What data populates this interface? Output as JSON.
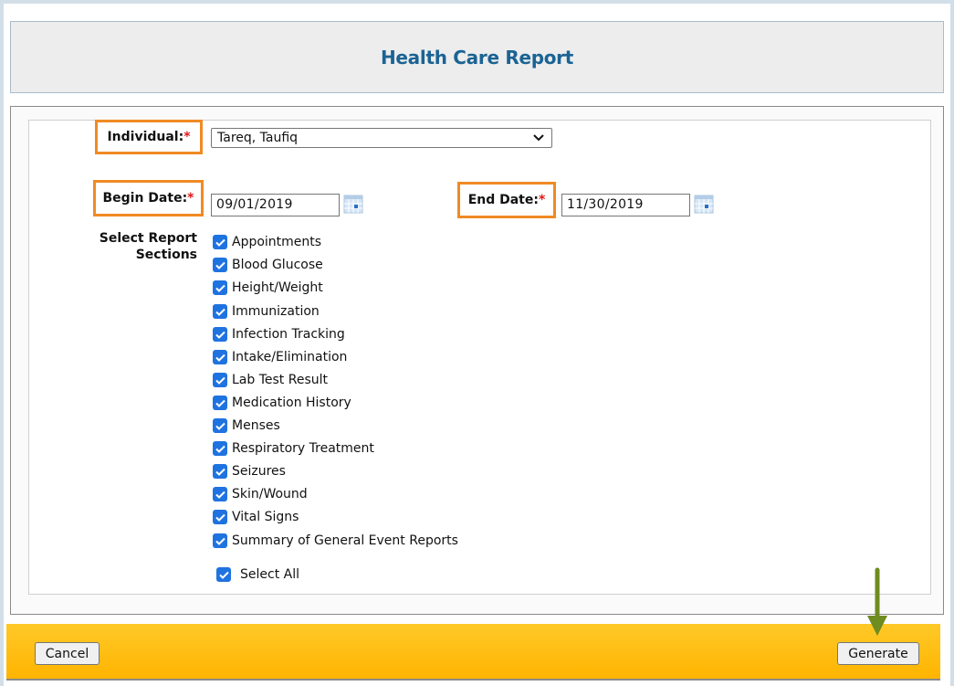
{
  "header": {
    "title": "Health Care Report"
  },
  "form": {
    "individual": {
      "label": "Individual:",
      "required_marker": "*",
      "value": "Tareq, Taufiq"
    },
    "begin_date": {
      "label": "Begin Date:",
      "required_marker": "*",
      "value": "09/01/2019"
    },
    "end_date": {
      "label": "End Date:",
      "required_marker": "*",
      "value": "11/30/2019"
    },
    "sections": {
      "label_line1": "Select Report",
      "label_line2": "Sections",
      "items": [
        {
          "label": "Appointments",
          "checked": true
        },
        {
          "label": "Blood Glucose",
          "checked": true
        },
        {
          "label": "Height/Weight",
          "checked": true
        },
        {
          "label": "Immunization",
          "checked": true
        },
        {
          "label": "Infection Tracking",
          "checked": true
        },
        {
          "label": "Intake/Elimination",
          "checked": true
        },
        {
          "label": "Lab Test Result",
          "checked": true
        },
        {
          "label": "Medication History",
          "checked": true
        },
        {
          "label": "Menses",
          "checked": true
        },
        {
          "label": "Respiratory Treatment",
          "checked": true
        },
        {
          "label": "Seizures",
          "checked": true
        },
        {
          "label": "Skin/Wound",
          "checked": true
        },
        {
          "label": "Vital Signs",
          "checked": true
        },
        {
          "label": "Summary of General Event Reports",
          "checked": true
        }
      ],
      "select_all": {
        "label": "Select All",
        "checked": true
      }
    }
  },
  "footer": {
    "cancel_label": "Cancel",
    "generate_label": "Generate"
  },
  "colors": {
    "title": "#1b6394",
    "highlight_border": "#f08a24",
    "required": "#e01818",
    "checkbox": "#1f73e0",
    "footer_top": "#ffc928",
    "footer_bottom": "#ffb400",
    "annotation_arrow": "#6e8c1f"
  }
}
